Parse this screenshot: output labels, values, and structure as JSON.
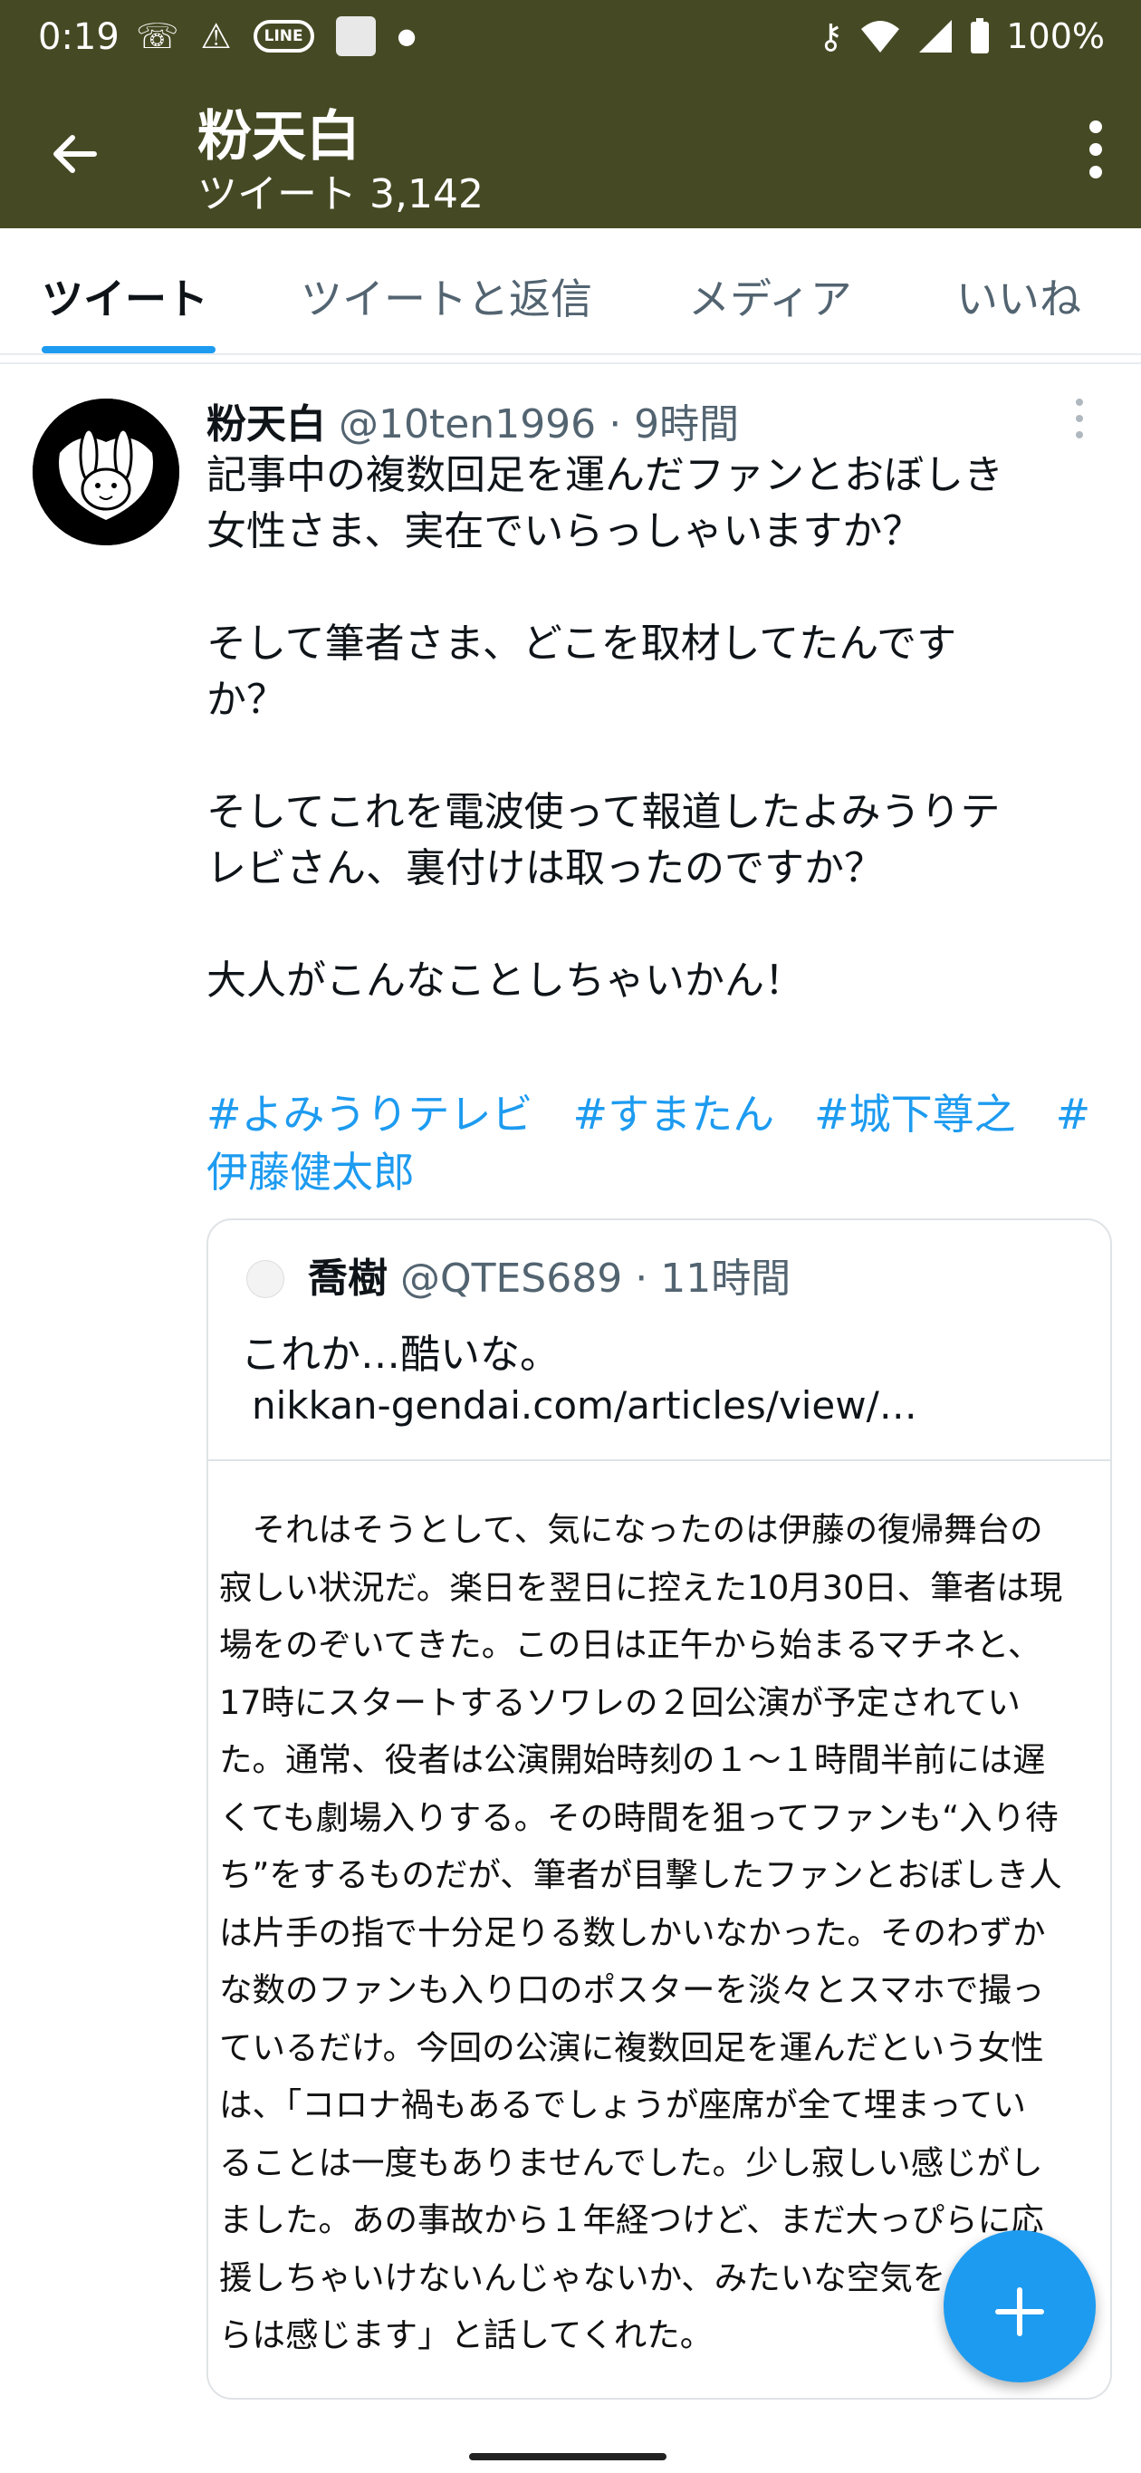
{
  "status_bar": {
    "time": "0:19",
    "line_badge": "LINE",
    "battery": "100%"
  },
  "app_bar": {
    "title": "粉天白",
    "subtitle": "ツイート 3,142"
  },
  "tabs": [
    "ツイート",
    "ツイートと返信",
    "メディア",
    "いいね"
  ],
  "tweet": {
    "name": "粉天白",
    "handle": "@10ten1996",
    "time": "9時間",
    "paragraphs": [
      [
        "記事中の複数回足を運んだファンとおぼしき",
        "女性さま、実在でいらっしゃいますか？"
      ],
      [
        "そして筆者さま、どこを取材してたんです",
        "か？"
      ],
      [
        "そしてこれを電波使って報道したよみうりテ",
        "レビさん、裏付けは取ったのですか？"
      ],
      [
        "大人がこんなことしちゃいかん！"
      ]
    ],
    "hashtags": [
      "#よみうりテレビ",
      "#すまたん",
      "#城下尊之",
      "#",
      "伊藤健太郎"
    ]
  },
  "quote": {
    "name": "喬樹",
    "handle": "@QTES689",
    "time": "11時間",
    "text": "これか…酷いな。",
    "link": "nikkan-gendai.com/articles/view/…",
    "article_lines": [
      "　それはそうとして、気になったのは伊藤の復帰舞台の",
      "寂しい状況だ。楽日を翌日に控えた10月30日、筆者は現",
      "場をのぞいてきた。この日は正午から始まるマチネと、",
      "17時にスタートするソワレの２回公演が予定されてい",
      "た。通常、役者は公演開始時刻の１～１時間半前には遅",
      "くても劇場入りする。その時間を狙ってファンも“入り待",
      "ち”をするものだが、筆者が目撃したファンとおぼしき人",
      "は片手の指で十分足りる数しかいなかった。そのわずか",
      "な数のファンも入り口のポスターを淡々とスマホで撮っ",
      "ているだけ。今回の公演に複数回足を運んだという女性",
      "は、「コロナ禍もあるでしょうが座席が全て埋まってい",
      "ることは一度もありませんでした。少し寂しい感じがし",
      "ました。あの事故から１年経つけど、まだ大っぴらに応",
      "援しちゃいけないんじゃないか、みたいな空気を",
      "らは感じます」と話してくれた。"
    ]
  },
  "icons": {
    "back": "back-arrow-icon",
    "more": "more-vert-icon",
    "fab": "compose-icon",
    "accent": "#1d9bf0",
    "header_bg": "#464a24"
  }
}
